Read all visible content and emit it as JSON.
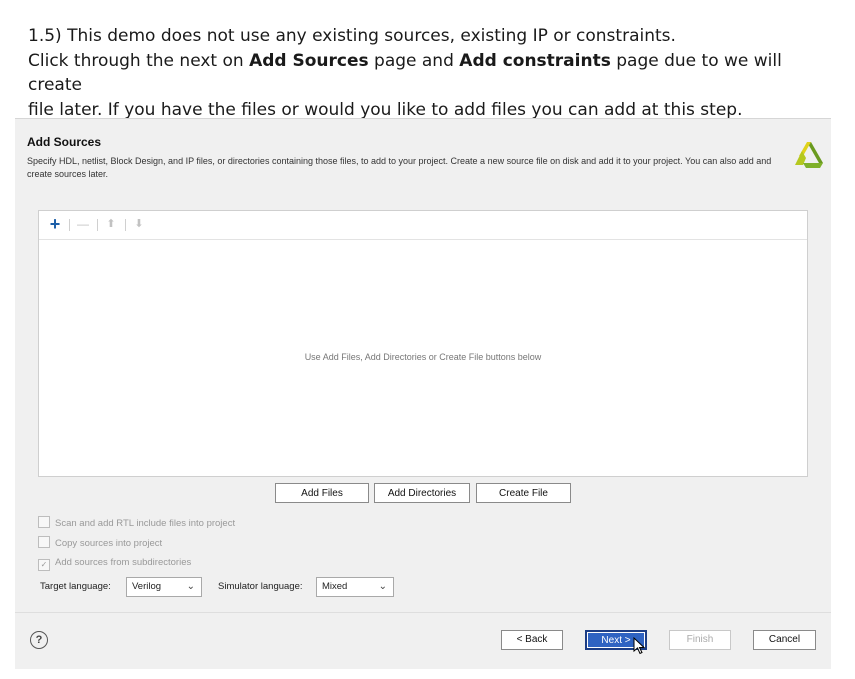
{
  "instructions": {
    "line1": "1.5) This demo does not use any existing sources, existing IP or constraints.",
    "line2_pre": "Click through the next on ",
    "line2_bold1": "Add Sources",
    "line2_mid": " page and ",
    "line2_bold2": "Add constraints",
    "line2_post": " page due to we will create",
    "line3": "file later. If you have the files or would you like to add files you can add at this step."
  },
  "dialog": {
    "title": "Add Sources",
    "description": "Specify HDL, netlist, Block Design, and IP files, or directories containing those files, to add to your project. Create a new source file on disk and add it to your project. You can also add and create sources later.",
    "logo_icon": "xilinx-logo-icon",
    "toolbar": {
      "add": "+",
      "remove": "—",
      "up": "⬆",
      "down": "⬇"
    },
    "empty_message": "Use Add Files, Add Directories or Create File buttons below",
    "buttons": {
      "add_files": "Add Files",
      "add_directories": "Add Directories",
      "create_file": "Create File"
    },
    "options": {
      "scan_rtl": "Scan and add RTL include files into project",
      "copy_sources": "Copy sources into project",
      "add_subdirs": "Add sources from subdirectories"
    },
    "target_language_label": "Target language:",
    "target_language_value": "Verilog",
    "simulator_language_label": "Simulator language:",
    "simulator_language_value": "Mixed",
    "footer": {
      "help": "?",
      "back": "< Back",
      "next": "Next >",
      "finish": "Finish",
      "cancel": "Cancel"
    }
  }
}
